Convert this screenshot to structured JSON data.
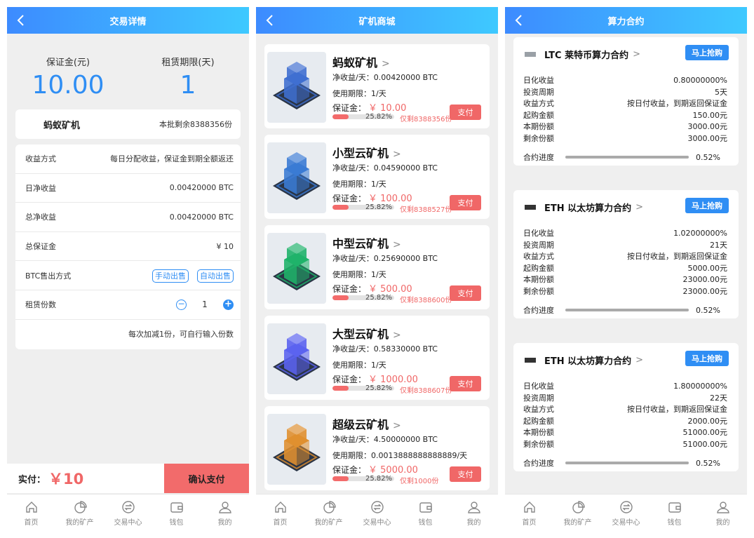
{
  "tabs": [
    "首页",
    "我的矿产",
    "交易中心",
    "钱包",
    "我的"
  ],
  "screen1": {
    "title": "交易详情",
    "deposit_label": "保证金(元)",
    "deposit_value": "10.00",
    "period_label": "租赁期限(天)",
    "period_value": "1",
    "machine_name": "蚂蚁矿机",
    "machine_remaining": "本批剩余8388356份",
    "rows": [
      {
        "label": "收益方式",
        "value": "每日分配收益，保证金到期全额返还"
      },
      {
        "label": "日净收益",
        "value": "0.00420000 BTC"
      },
      {
        "label": "总净收益",
        "value": "0.00420000 BTC"
      },
      {
        "label": "总保证金",
        "value": "¥ 10"
      }
    ],
    "sell_label": "BTC售出方式",
    "sell_manual": "手动出售",
    "sell_auto": "自动出售",
    "qty_label": "租赁份数",
    "qty_value": "1",
    "hint": "每次加减1份，可自行输入份数",
    "pay_label": "实付：",
    "pay_value": "￥10",
    "confirm_label": "确认支付"
  },
  "screen2": {
    "title": "矿机商城",
    "products": [
      {
        "name": "蚂蚁矿机",
        "income": "净收益/天：0.00420000 BTC",
        "period": "使用期限：1/天",
        "deposit": "￥ 10.00",
        "progress": 25.82,
        "progress_label": "25.82%",
        "remaining": "仅剩8388356份",
        "color": "#3f6fd0"
      },
      {
        "name": "小型云矿机",
        "income": "净收益/天：0.04590000 BTC",
        "period": "使用期限：1/天",
        "deposit": "￥ 100.00",
        "progress": 25.82,
        "progress_label": "25.82%",
        "remaining": "仅剩8388527份",
        "color": "#3b7bd4"
      },
      {
        "name": "中型云矿机",
        "income": "净收益/天：0.25690000 BTC",
        "period": "使用期限：1/天",
        "deposit": "￥ 500.00",
        "progress": 25.82,
        "progress_label": "25.82%",
        "remaining": "仅剩8388600份",
        "color": "#1fb36a"
      },
      {
        "name": "大型云矿机",
        "income": "净收益/天：0.58330000 BTC",
        "period": "使用期限：1/天",
        "deposit": "￥ 1000.00",
        "progress": 25.82,
        "progress_label": "25.82%",
        "remaining": "仅剩8388607份",
        "color": "#5b63f0"
      },
      {
        "name": "超级云矿机",
        "income": "净收益/天：4.50000000 BTC",
        "period": "使用期限：0.0013888888888889/天",
        "deposit": "￥ 5000.00",
        "progress": 25.82,
        "progress_label": "25.82%",
        "remaining": "仅剩1000份",
        "color": "#e09030"
      }
    ],
    "deposit_label": "保证金：",
    "pay_label": "支付"
  },
  "screen3": {
    "title": "算力合约",
    "buy_label": "马上抢购",
    "progress_label": "合约进度",
    "contracts": [
      {
        "name": "LTC 莱特币算力合约",
        "rows": [
          {
            "label": "日化收益",
            "value": "0.80000000%"
          },
          {
            "label": "投资周期",
            "value": "5天"
          },
          {
            "label": "收益方式",
            "value": "按日付收益，到期返回保证金"
          },
          {
            "label": "起购金额",
            "value": "150.00元"
          },
          {
            "label": "本期份额",
            "value": "3000.00元"
          },
          {
            "label": "剩余份额",
            "value": "3000.00元"
          }
        ],
        "progress": "0.52%"
      },
      {
        "name": "ETH 以太坊算力合约",
        "rows": [
          {
            "label": "日化收益",
            "value": "1.02000000%"
          },
          {
            "label": "投资周期",
            "value": "21天"
          },
          {
            "label": "收益方式",
            "value": "按日付收益，到期返回保证金"
          },
          {
            "label": "起购金额",
            "value": "5000.00元"
          },
          {
            "label": "本期份额",
            "value": "23000.00元"
          },
          {
            "label": "剩余份额",
            "value": "23000.00元"
          }
        ],
        "progress": "0.52%"
      },
      {
        "name": "ETH 以太坊算力合约",
        "rows": [
          {
            "label": "日化收益",
            "value": "1.80000000%"
          },
          {
            "label": "投资周期",
            "value": "22天"
          },
          {
            "label": "收益方式",
            "value": "按日付收益，到期返回保证金"
          },
          {
            "label": "起购金额",
            "value": "2000.00元"
          },
          {
            "label": "本期份额",
            "value": "51000.00元"
          },
          {
            "label": "剩余份额",
            "value": "51000.00元"
          }
        ],
        "progress": "0.52%"
      }
    ]
  }
}
